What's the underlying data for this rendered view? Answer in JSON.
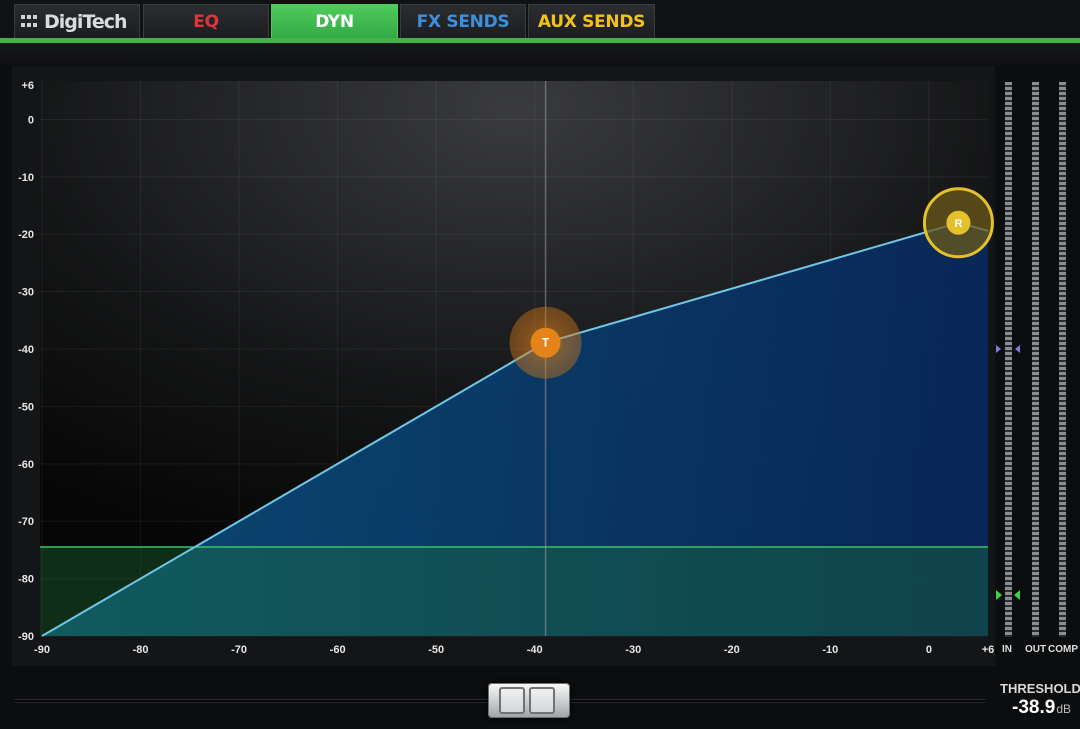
{
  "brand": {
    "logo_text": "DigiTech"
  },
  "tabs": [
    {
      "label": "EQ",
      "color": "#e0343e",
      "active": false
    },
    {
      "label": "DYN",
      "color": "#ffffff",
      "active": true
    },
    {
      "label": "FX SENDS",
      "color": "#3f8fd8",
      "active": false
    },
    {
      "label": "AUX SENDS",
      "color": "#f0c21a",
      "active": false
    }
  ],
  "graph": {
    "x_ticks": [
      "-90",
      "-80",
      "-70",
      "-60",
      "-50",
      "-40",
      "-30",
      "-20",
      "-10",
      "0",
      "+6"
    ],
    "y_ticks": [
      "+6",
      "0",
      "-10",
      "-20",
      "-30",
      "-40",
      "-50",
      "-60",
      "-70",
      "-80",
      "-90"
    ],
    "x_range": [
      -90,
      6
    ],
    "y_range": [
      -90,
      6
    ],
    "threshold_db": -38.9,
    "gate_level_db": -74.5,
    "curve_points": [
      [
        -90,
        -90
      ],
      [
        -38.9,
        -38.9
      ],
      [
        3,
        -18.0
      ]
    ],
    "threshold_handle_label": "T",
    "ratio_handle_label": "R",
    "colors": {
      "curve": "#6fc6e8",
      "fill": "#0d3a66",
      "gate": "#1f7a3a",
      "threshold_handle": "#e5831b",
      "ratio_handle": "#e3c02c"
    }
  },
  "meters": {
    "labels": [
      "IN",
      "OUT",
      "COMP"
    ]
  },
  "threshold": {
    "label": "THRESHOLD",
    "value": "-38.9",
    "unit": "dB"
  }
}
